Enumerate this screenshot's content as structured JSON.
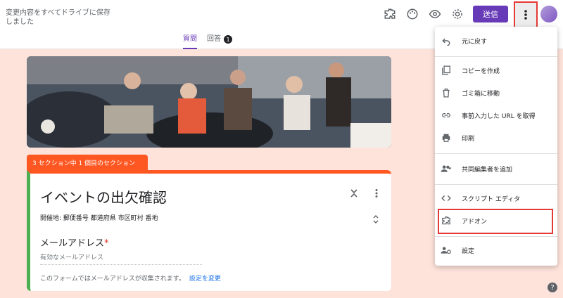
{
  "header": {
    "save_status": "変更内容をすべてドライブに保存しました",
    "send_label": "送信",
    "icons": [
      "puzzle-icon",
      "palette-icon",
      "eye-icon",
      "gear-icon",
      "more-vert-icon"
    ]
  },
  "tabs": [
    {
      "label": "質問",
      "active": true
    },
    {
      "label": "回答",
      "badge": "1",
      "active": false
    }
  ],
  "section_tag": "3 セクション中 1 個目のセクション",
  "form": {
    "title": "イベントの出欠確認",
    "description": "開催地: 郵便番号 都道府県 市区町村 番地",
    "email_label": "メールアドレス",
    "required_mark": "*",
    "email_placeholder": "有効なメールアドレス",
    "notice": "このフォームではメールアドレスが収集されます。",
    "notice_link": "設定を変更"
  },
  "menu": {
    "items": [
      {
        "label": "元に戻す",
        "icon": "undo-icon"
      },
      {
        "label": "コピーを作成",
        "icon": "copy-icon"
      },
      {
        "label": "ゴミ箱に移動",
        "icon": "trash-icon"
      },
      {
        "label": "事前入力した URL を取得",
        "icon": "link-icon"
      },
      {
        "label": "印刷",
        "icon": "print-icon"
      },
      {
        "label": "共同編集者を追加",
        "icon": "add-people-icon"
      },
      {
        "label": "スクリプト エディタ",
        "icon": "code-icon"
      },
      {
        "label": "アドオン",
        "icon": "puzzle-icon"
      },
      {
        "label": "設定",
        "icon": "person-settings-icon"
      }
    ]
  },
  "colors": {
    "accent": "#673ab7",
    "section": "#ff5722",
    "highlight": "#e53935",
    "background": "#fde3da"
  }
}
